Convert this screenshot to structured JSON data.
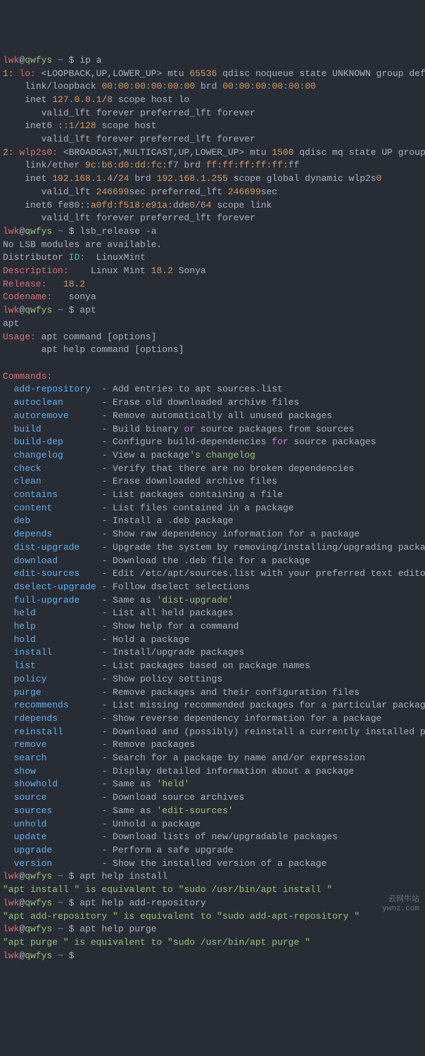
{
  "prompt": {
    "user": "lwk",
    "host": "qwfys",
    "path": "~",
    "sep": "$"
  },
  "commands": {
    "ipa": "ip a",
    "lsb": "lsb_release -a",
    "apt": "apt",
    "apthelp1": "apt help install",
    "apthelp2": "apt help add-repository",
    "apthelp3": "apt help purge"
  },
  "ip": {
    "iface1": {
      "idx": "1:",
      "name": "lo:",
      "flags": "<LOOPBACK,UP,LOWER_UP>",
      "mtu_l": "mtu",
      "mtu_v": "65536",
      "tail": "qdisc noqueue state UNKNOWN group default qlen",
      "link_l": "link/loopback",
      "mac": "00",
      "sep": ":",
      "brd_l": "brd",
      "inet_l": "inet",
      "inet_v": "127.0.0.1",
      "slash": "/",
      "pfx4": "8",
      "scope4": "scope host lo",
      "valid": "valid_lft forever preferred_lft forever",
      "inet6_l": "inet6",
      "inet6_v": "::1",
      "pfx6": "128",
      "scope6": "scope host"
    },
    "iface2": {
      "idx": "2:",
      "name": "wlp2s0:",
      "flags": "<BROADCAST,MULTICAST,UP,LOWER_UP>",
      "mtu_l": "mtu",
      "mtu_v": "1500",
      "tail": "qdisc mq state UP group default",
      "link_l": "link/ether",
      "mac_a": "9c",
      "mac_b": "b6:d0:dd:fc:",
      "mac_c": "f7",
      "brd_l": "brd",
      "brd_a": "ff:ff:ff:ff:ff:",
      "brd_b": "ff",
      "inet_l": "inet",
      "inet_v": "192.168.1.4",
      "slash": "/",
      "pfx4": "24",
      "brd4_l": "brd",
      "brd4_v": "192.168.1.255",
      "scope4a": "scope global dynamic wlp2s",
      "scope4b": "0",
      "valid_a": "valid_lft",
      "valid_v": "246699",
      "valid_b": "sec preferred_lft",
      "valid_c": "sec",
      "inet6_l": "inet6",
      "inet6_a": "fe80::",
      "inet6_b": "a0fd:f518:e91a:",
      "inet6_c": "dde",
      "inet6_d": "0",
      "inet6_e": "/",
      "inet6_f": "64",
      "scope6": "scope link",
      "valid2": "valid_lft forever preferred_lft forever"
    }
  },
  "lsb": {
    "noMods": "No LSB modules are available.",
    "distL": "Distributor",
    "idL": "ID:",
    "distV": "LinuxMint",
    "descL": "Description:",
    "descV1": "Linux Mint",
    "descV2": "18.2",
    "descV3": "Sonya",
    "relL": "Release:",
    "relV": "18.2",
    "codeL": "Codename:",
    "codeV": "sonya"
  },
  "apt_out": {
    "echo": "apt",
    "usageL": "Usage:",
    "usage1": "apt command [options]",
    "usage2": "apt help command [options]",
    "commandsL": "Commands:",
    "list": [
      {
        "c": "add-repository",
        "d": "Add entries to apt sources.list"
      },
      {
        "c": "autoclean",
        "d": "Erase old downloaded archive files"
      },
      {
        "c": "autoremove",
        "d": "Remove automatically all unused packages"
      },
      {
        "c": "build",
        "d1": "Build binary ",
        "kw": "or",
        "d2": " source packages from sources"
      },
      {
        "c": "build-dep",
        "d1": "Configure build-dependencies ",
        "kw": "for",
        "d2": " source packages"
      },
      {
        "c": "changelog",
        "d1": "View a package",
        "q": "'s changelog"
      },
      {
        "c": "check",
        "d": "Verify that there are no broken dependencies"
      },
      {
        "c": "clean",
        "d": "Erase downloaded archive files"
      },
      {
        "c": "contains",
        "d": "List packages containing a file"
      },
      {
        "c": "content",
        "d": "List files contained in a package"
      },
      {
        "c": "deb",
        "d": "Install a .deb package"
      },
      {
        "c": "depends",
        "d": "Show raw dependency information for a package"
      },
      {
        "c": "dist-upgrade",
        "d": "Upgrade the system by removing/installing/upgrading packages"
      },
      {
        "c": "download",
        "d": "Download the .deb file for a package"
      },
      {
        "c": "edit-sources",
        "d": "Edit /etc/apt/sources.list with your preferred text editor"
      },
      {
        "c": "dselect-upgrade",
        "d": "Follow dselect selections"
      },
      {
        "c": "full-upgrade",
        "d1": "Same as ",
        "q": "'dist-upgrade'"
      },
      {
        "c": "held",
        "d": "List all held packages"
      },
      {
        "c": "help",
        "d": "Show help for a command"
      },
      {
        "c": "hold",
        "d": "Hold a package"
      },
      {
        "c": "install",
        "d": "Install/upgrade packages"
      },
      {
        "c": "list",
        "d": "List packages based on package names"
      },
      {
        "c": "policy",
        "d": "Show policy settings"
      },
      {
        "c": "purge",
        "d": "Remove packages and their configuration files"
      },
      {
        "c": "recommends",
        "d": "List missing recommended packages for a particular package"
      },
      {
        "c": "rdepends",
        "d": "Show reverse dependency information for a package"
      },
      {
        "c": "reinstall",
        "d": "Download and (possibly) reinstall a currently installed package"
      },
      {
        "c": "remove",
        "d": "Remove packages"
      },
      {
        "c": "search",
        "d": "Search for a package by name and/or expression"
      },
      {
        "c": "show",
        "d": "Display detailed information about a package"
      },
      {
        "c": "showhold",
        "d1": "Same as ",
        "q": "'held'"
      },
      {
        "c": "source",
        "d": "Download source archives"
      },
      {
        "c": "sources",
        "d1": "Same as ",
        "q": "'edit-sources'"
      },
      {
        "c": "unhold",
        "d": "Unhold a package"
      },
      {
        "c": "update",
        "d": "Download lists of new/upgradable packages"
      },
      {
        "c": "upgrade",
        "d": "Perform a safe upgrade"
      },
      {
        "c": "version",
        "d": "Show the installed version of a package"
      }
    ]
  },
  "help_out": {
    "h1": "\"apt install \" is equivalent to \"sudo /usr/bin/apt install \"",
    "h2": "\"apt add-repository \" is equivalent to \"sudo add-apt-repository \"",
    "h3": "\"apt purge \" is equivalent to \"sudo /usr/bin/apt purge \""
  },
  "watermark": {
    "l1": "云网牛站",
    "l2": "ywnz.com"
  }
}
